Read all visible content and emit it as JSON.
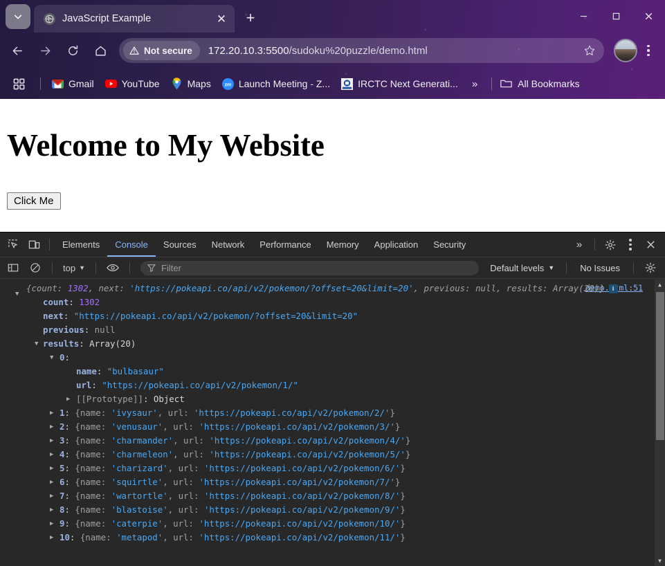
{
  "window": {
    "controls": {
      "minimize": "—",
      "maximize": "□",
      "close": "✕"
    }
  },
  "tabstrip": {
    "tab_search_icon": "chevron-down-icon",
    "tabs": [
      {
        "title": "JavaScript Example",
        "favicon": "globe-icon",
        "close": "✕",
        "active": true
      }
    ],
    "new_tab": "+"
  },
  "navbar": {
    "back": "←",
    "forward": "→",
    "reload": "↻",
    "home": "home-icon",
    "security_label": "Not secure",
    "url_host": "172.20.10.3:5500",
    "url_path": "/sudoku%20puzzle/demo.html",
    "bookmark_star": "star-icon",
    "profile": "avatar",
    "menu": "kebab-menu"
  },
  "bookmarks": {
    "apps_icon": "apps-grid-icon",
    "items": [
      {
        "label": "Gmail",
        "icon": "gmail-icon"
      },
      {
        "label": "YouTube",
        "icon": "youtube-icon"
      },
      {
        "label": "Maps",
        "icon": "maps-pin-icon"
      },
      {
        "label": "Launch Meeting - Z...",
        "icon": "zoom-icon"
      },
      {
        "label": "IRCTC Next Generati...",
        "icon": "irctc-icon"
      }
    ],
    "overflow": "»",
    "all_bookmarks": "All Bookmarks"
  },
  "page": {
    "heading": "Welcome to My Website",
    "button_label": "Click Me"
  },
  "devtools": {
    "inspect_icon": "inspect-element-icon",
    "device_icon": "device-toolbar-icon",
    "tabs": [
      {
        "label": "Elements",
        "active": false
      },
      {
        "label": "Console",
        "active": true
      },
      {
        "label": "Sources",
        "active": false
      },
      {
        "label": "Network",
        "active": false
      },
      {
        "label": "Performance",
        "active": false
      },
      {
        "label": "Memory",
        "active": false
      },
      {
        "label": "Application",
        "active": false
      },
      {
        "label": "Security",
        "active": false
      }
    ],
    "more_tabs": "»",
    "settings_icon": "gear-icon",
    "kebab_icon": "kebab-menu-icon",
    "close_icon": "close-icon",
    "toolbar": {
      "sidebar_icon": "console-sidebar-icon",
      "clear_icon": "clear-console-icon",
      "context": "top",
      "context_caret": "▼",
      "eye_icon": "live-expression-icon",
      "filter_icon": "filter-icon",
      "filter_placeholder": "Filter",
      "levels_label": "Default levels",
      "levels_caret": "▼",
      "issues_label": "No Issues",
      "settings_icon": "gear-icon"
    },
    "console": {
      "source_link": "demo.html:51",
      "preview": {
        "open": "{",
        "count_key": "count",
        "count_val": "1302",
        "next_key": "next",
        "next_val": "'https://pokeapi.co/api/v2/pokemon/?offset=20&limit=20'",
        "prev_key": "previous",
        "prev_val": "null",
        "results_key": "results",
        "results_val": "Array(20)",
        "close": "}",
        "info_badge": "i"
      },
      "props": [
        {
          "key": "count",
          "value": "1302",
          "type": "number"
        },
        {
          "key": "next",
          "value": "\"https://pokeapi.co/api/v2/pokemon/?offset=20&limit=20\"",
          "type": "string"
        },
        {
          "key": "previous",
          "value": "null",
          "type": "null"
        }
      ],
      "results_label": "results",
      "results_value": "Array(20)",
      "index0_label": "0",
      "index0_props": [
        {
          "key": "name",
          "value": "\"bulbasaur\""
        },
        {
          "key": "url",
          "value": "\"https://pokeapi.co/api/v2/pokemon/1/\""
        }
      ],
      "prototype_label": "[[Prototype]]",
      "prototype_value": "Object",
      "rows": [
        {
          "index": "1",
          "name": "'ivysaur'",
          "url": "'https://pokeapi.co/api/v2/pokemon/2/'"
        },
        {
          "index": "2",
          "name": "'venusaur'",
          "url": "'https://pokeapi.co/api/v2/pokemon/3/'"
        },
        {
          "index": "3",
          "name": "'charmander'",
          "url": "'https://pokeapi.co/api/v2/pokemon/4/'"
        },
        {
          "index": "4",
          "name": "'charmeleon'",
          "url": "'https://pokeapi.co/api/v2/pokemon/5/'"
        },
        {
          "index": "5",
          "name": "'charizard'",
          "url": "'https://pokeapi.co/api/v2/pokemon/6/'"
        },
        {
          "index": "6",
          "name": "'squirtle'",
          "url": "'https://pokeapi.co/api/v2/pokemon/7/'"
        },
        {
          "index": "7",
          "name": "'wartortle'",
          "url": "'https://pokeapi.co/api/v2/pokemon/8/'"
        },
        {
          "index": "8",
          "name": "'blastoise'",
          "url": "'https://pokeapi.co/api/v2/pokemon/9/'"
        },
        {
          "index": "9",
          "name": "'caterpie'",
          "url": "'https://pokeapi.co/api/v2/pokemon/10/'"
        },
        {
          "index": "10",
          "name": "'metapod'",
          "url": "'https://pokeapi.co/api/v2/pokemon/11/'"
        }
      ],
      "row_prefix": "{name: ",
      "row_mid": ", url: ",
      "row_suffix": "}"
    }
  },
  "colors": {
    "accent_blue": "#8ab4f8",
    "string_blue": "#49a8f5",
    "number_purple": "#a371f7",
    "devtools_bg": "#282828"
  }
}
